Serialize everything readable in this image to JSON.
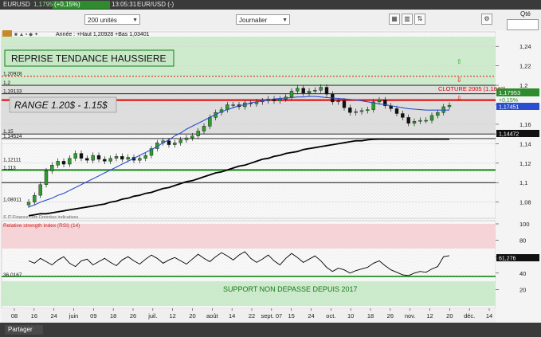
{
  "window": {
    "symbol": "EURUSD",
    "last_price": "1,17953",
    "change_pct": "(+0,15%)",
    "time": "13:05:31",
    "pair_suffix": "EUR/USD (-)"
  },
  "toolbar": {
    "quantity": "200 unités",
    "period": "Journalier",
    "qty_label": "Qté"
  },
  "chart_info": "Année : +Haut 1,20928 +Bas 1,03401",
  "source_note": "© IT-Finance.com Données indicatives",
  "annotations": {
    "reprise": "REPRISE TENDANCE HAUSSIERE",
    "range": "RANGE 1.20$ - 1.15$",
    "cloture": "CLOTURE 2005 (1.1848)",
    "support": "SUPPORT NON DEPASSE DEPUIS 2017"
  },
  "level_labels": [
    "1,20928",
    "1,2",
    "1,19133",
    "1,15",
    "1,14524",
    "1,12111",
    "1,113",
    "1,08011"
  ],
  "price_tags": {
    "last": "1,17953",
    "change": "+0,15%",
    "ma": "1,17451",
    "ma2": "1,14472"
  },
  "rsi_tags": {
    "current": "61,276",
    "support": "36,0167"
  },
  "rsi_title": "Relative strength index (RSI) (14)",
  "statusbar": {
    "share": "Partager"
  },
  "chart_data": {
    "type": "candlestick",
    "symbol": "EURUSD",
    "ylim": [
      1.065,
      1.25
    ],
    "y_ticks": [
      "1,24",
      "1,22",
      "1,2",
      "1,18",
      "1,16",
      "1,14",
      "1,12",
      "1,1",
      "1,08"
    ],
    "x_ticks": [
      "08",
      "16",
      "24",
      "juin",
      "09",
      "18",
      "26",
      "juil.",
      "12",
      "20",
      "août",
      "14",
      "22",
      "sept. 07",
      "15",
      "24",
      "oct.",
      "10",
      "18",
      "26",
      "nov.",
      "12",
      "20",
      "déc.",
      "14"
    ],
    "closes": [
      1.08,
      1.087,
      1.098,
      1.112,
      1.118,
      1.122,
      1.119,
      1.125,
      1.13,
      1.125,
      1.123,
      1.128,
      1.124,
      1.122,
      1.125,
      1.127,
      1.124,
      1.126,
      1.123,
      1.125,
      1.128,
      1.135,
      1.141,
      1.143,
      1.139,
      1.141,
      1.144,
      1.146,
      1.148,
      1.153,
      1.158,
      1.167,
      1.172,
      1.175,
      1.18,
      1.18,
      1.178,
      1.182,
      1.181,
      1.183,
      1.184,
      1.186,
      1.184,
      1.186,
      1.188,
      1.194,
      1.197,
      1.192,
      1.194,
      1.195,
      1.198,
      1.191,
      1.183,
      1.184,
      1.177,
      1.172,
      1.173,
      1.174,
      1.175,
      1.183,
      1.185,
      1.179,
      1.176,
      1.171,
      1.167,
      1.161,
      1.163,
      1.164,
      1.164,
      1.169,
      1.172,
      1.178,
      1.1795
    ],
    "sma": {
      "name": "",
      "values": [
        1.075,
        1.077,
        1.08,
        1.082,
        1.084,
        1.087,
        1.089,
        1.092,
        1.095,
        1.098,
        1.101,
        1.104,
        1.107,
        1.11,
        1.113,
        1.116,
        1.119,
        1.122,
        1.125,
        1.128,
        1.131,
        1.134,
        1.137,
        1.141,
        1.144,
        1.148,
        1.151,
        1.155,
        1.158,
        1.161,
        1.164,
        1.167,
        1.17,
        1.173,
        1.175,
        1.177,
        1.179,
        1.18,
        1.182,
        1.183,
        1.184,
        1.185,
        1.186,
        1.1865,
        1.187,
        1.1875,
        1.188,
        1.188,
        1.1885,
        1.1885,
        1.188,
        1.1875,
        1.187,
        1.1865,
        1.186,
        1.1855,
        1.185,
        1.184,
        1.183,
        1.182,
        1.181,
        1.18,
        1.179,
        1.178,
        1.177,
        1.176,
        1.1755,
        1.175,
        1.1745,
        1.1745,
        1.1745,
        1.1745,
        1.1745
      ]
    },
    "sma_long": {
      "name": "",
      "values": [
        1.066,
        1.067,
        1.068,
        1.068,
        1.069,
        1.07,
        1.071,
        1.072,
        1.073,
        1.074,
        1.075,
        1.076,
        1.077,
        1.078,
        1.08,
        1.081,
        1.083,
        1.084,
        1.086,
        1.087,
        1.089,
        1.09,
        1.092,
        1.094,
        1.095,
        1.097,
        1.099,
        1.101,
        1.102,
        1.104,
        1.106,
        1.108,
        1.11,
        1.111,
        1.113,
        1.115,
        1.117,
        1.118,
        1.12,
        1.122,
        1.124,
        1.125,
        1.127,
        1.128,
        1.13,
        1.131,
        1.132,
        1.134,
        1.135,
        1.136,
        1.137,
        1.138,
        1.139,
        1.14,
        1.141,
        1.142,
        1.143,
        1.143,
        1.144,
        1.1445,
        1.1447,
        1.1447,
        1.1447,
        1.1447,
        1.1447,
        1.1447,
        1.1447,
        1.1447,
        1.1447,
        1.1447,
        1.1447,
        1.1447,
        1.1447
      ]
    },
    "levels": [
      {
        "value": 1.20928,
        "style": "dotted",
        "color": "#d11"
      },
      {
        "value": 1.2,
        "style": "solid",
        "color": "#111"
      },
      {
        "value": 1.19133,
        "style": "solid",
        "color": "#111"
      },
      {
        "value": 1.1848,
        "style": "thick",
        "color": "#e00000"
      },
      {
        "value": 1.15,
        "style": "solid",
        "color": "#111"
      },
      {
        "value": 1.14524,
        "style": "solid",
        "color": "#111"
      },
      {
        "value": 1.113,
        "style": "thick",
        "color": "#118811"
      },
      {
        "value": 1.1,
        "style": "solid",
        "color": "#111"
      }
    ],
    "rsi": {
      "ylim": [
        0,
        100
      ],
      "y_ticks": [
        100,
        80,
        60,
        40,
        20
      ],
      "overbought": 70,
      "oversold": 30,
      "support": 36.0167,
      "values": [
        55,
        52,
        58,
        54,
        50,
        56,
        60,
        52,
        48,
        55,
        57,
        50,
        54,
        58,
        53,
        49,
        56,
        60,
        55,
        51,
        57,
        62,
        58,
        52,
        56,
        59,
        55,
        51,
        57,
        63,
        58,
        54,
        60,
        65,
        61,
        56,
        62,
        66,
        58,
        53,
        57,
        62,
        55,
        50,
        58,
        64,
        59,
        53,
        57,
        61,
        55,
        47,
        42,
        46,
        44,
        40,
        43,
        45,
        47,
        52,
        55,
        49,
        44,
        41,
        38,
        37,
        40,
        42,
        41,
        45,
        48,
        60,
        61.276
      ]
    }
  }
}
